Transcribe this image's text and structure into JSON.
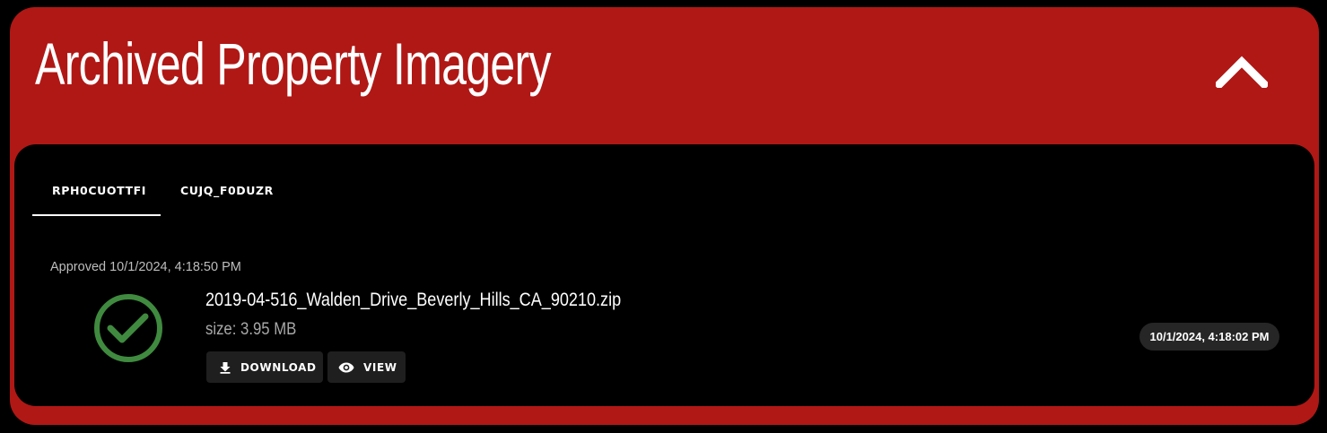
{
  "panel": {
    "title": "Archived Property Imagery",
    "toggle_icon": "chevron-up-icon",
    "colors": {
      "accent": "#b01815",
      "success": "#3f8a3f",
      "surface": "#000000"
    }
  },
  "tabs": [
    {
      "label": "RPH0CUOTTFI",
      "active": true
    },
    {
      "label": "CUJQ_F0DUZR",
      "active": false
    }
  ],
  "record": {
    "approved_text": "Approved 10/1/2024, 4:18:50 PM",
    "status_icon": "check-circle-icon",
    "file_name": "2019-04-516_Walden_Drive_Beverly_Hills_CA_90210.zip",
    "file_size": "size: 3.95 MB",
    "timestamp": "10/1/2024, 4:18:02 PM",
    "actions": {
      "download_label": "DOWNLOAD",
      "download_icon": "download-icon",
      "view_label": "VIEW",
      "view_icon": "eye-icon"
    }
  }
}
